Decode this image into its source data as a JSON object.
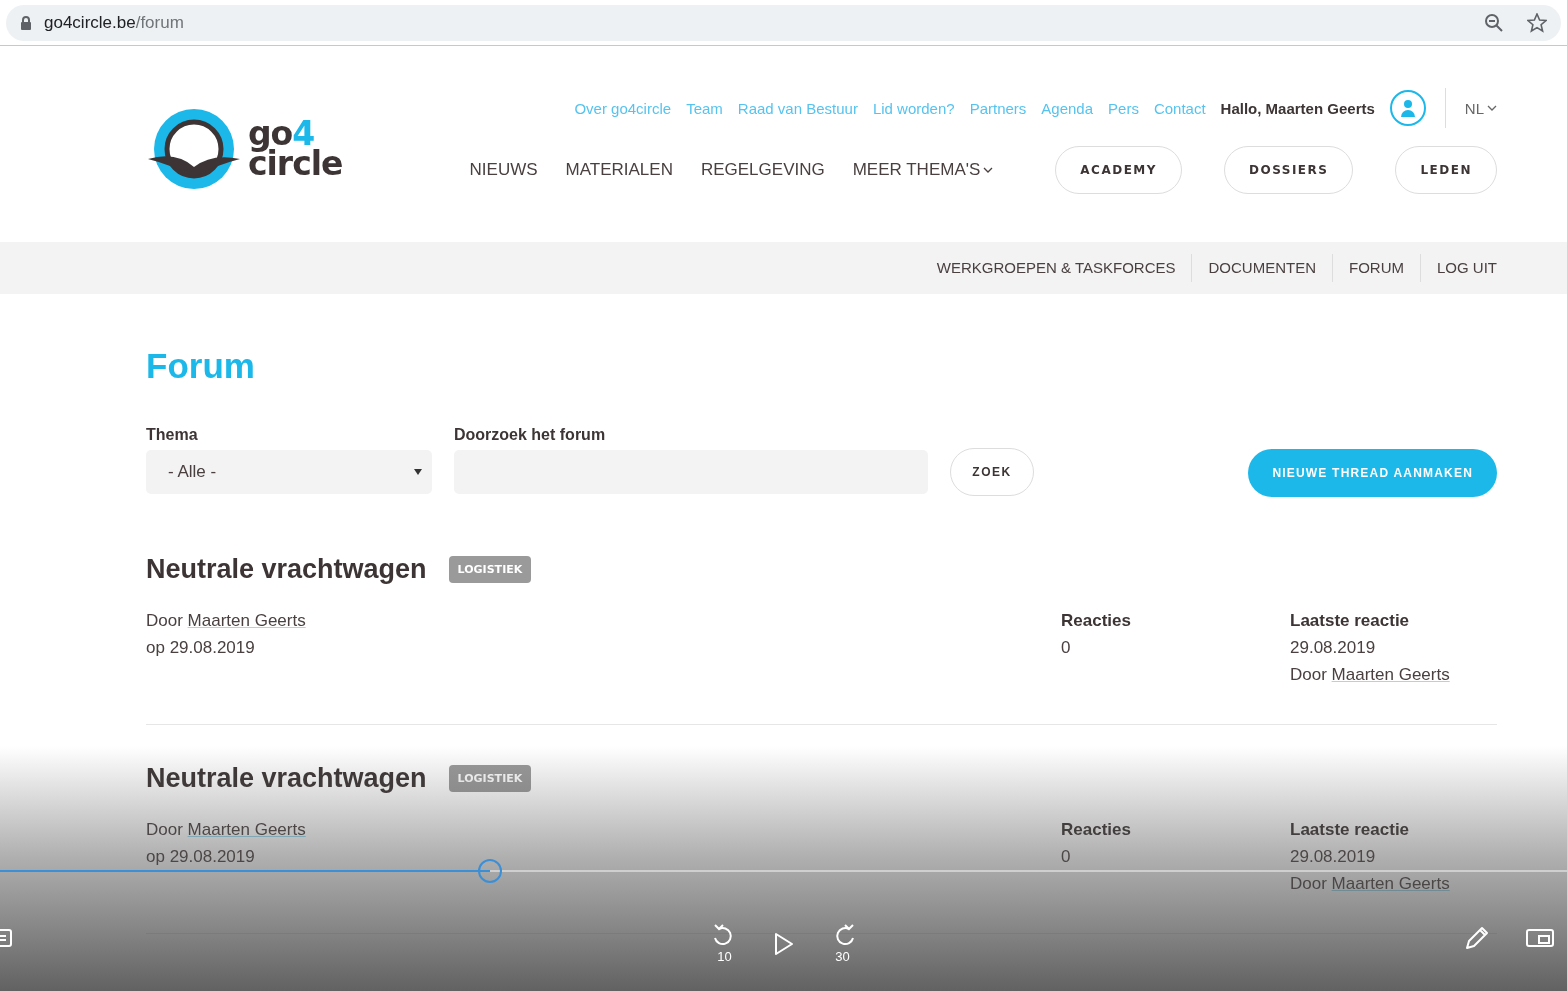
{
  "browser": {
    "url_host": "go4circle.be",
    "url_path": "/forum"
  },
  "logo": {
    "top": "go",
    "digit": "4",
    "bottom": "circle"
  },
  "top_links": [
    "Over go4circle",
    "Team",
    "Raad van Bestuur",
    "Lid worden?",
    "Partners",
    "Agenda",
    "Pers",
    "Contact"
  ],
  "user": {
    "greeting": "Hallo, Maarten Geerts",
    "language": "NL"
  },
  "main_nav": [
    {
      "label": "NIEUWS",
      "kind": "link"
    },
    {
      "label": "MATERIALEN",
      "kind": "link"
    },
    {
      "label": "REGELGEVING",
      "kind": "link"
    },
    {
      "label": "MEER THEMA'S",
      "kind": "dropdown"
    }
  ],
  "pill_buttons": [
    "ACADEMY",
    "DOSSIERS",
    "LEDEN"
  ],
  "sub_nav": [
    "WERKGROEPEN & TASKFORCES",
    "DOCUMENTEN",
    "FORUM",
    "LOG UIT"
  ],
  "page_title": "Forum",
  "filters": {
    "theme_label": "Thema",
    "theme_value": "- Alle -",
    "search_label": "Doorzoek het forum",
    "search_button": "ZOEK",
    "new_thread_button": "NIEUWE THREAD AANMAKEN"
  },
  "threads": [
    {
      "title": "Neutrale vrachtwagen",
      "tag": "LOGISTIEK",
      "by_prefix": "Door",
      "author": "Maarten Geerts",
      "date": "op 29.08.2019",
      "replies_label": "Reacties",
      "replies": "0",
      "last_label": "Laatste reactie",
      "last_date": "29.08.2019",
      "last_by_prefix": "Door",
      "last_author": "Maarten Geerts"
    },
    {
      "title": "Neutrale vrachtwagen",
      "tag": "LOGISTIEK",
      "by_prefix": "Door",
      "author": "Maarten Geerts",
      "date": "op 29.08.2019",
      "replies_label": "Reacties",
      "replies": "0",
      "last_label": "Laatste reactie",
      "last_date": "29.08.2019",
      "last_by_prefix": "Door",
      "last_author": "Maarten Geerts"
    }
  ],
  "player": {
    "progress": {
      "level": 0.313
    },
    "rewind_seconds": "10",
    "forward_seconds": "30"
  }
}
